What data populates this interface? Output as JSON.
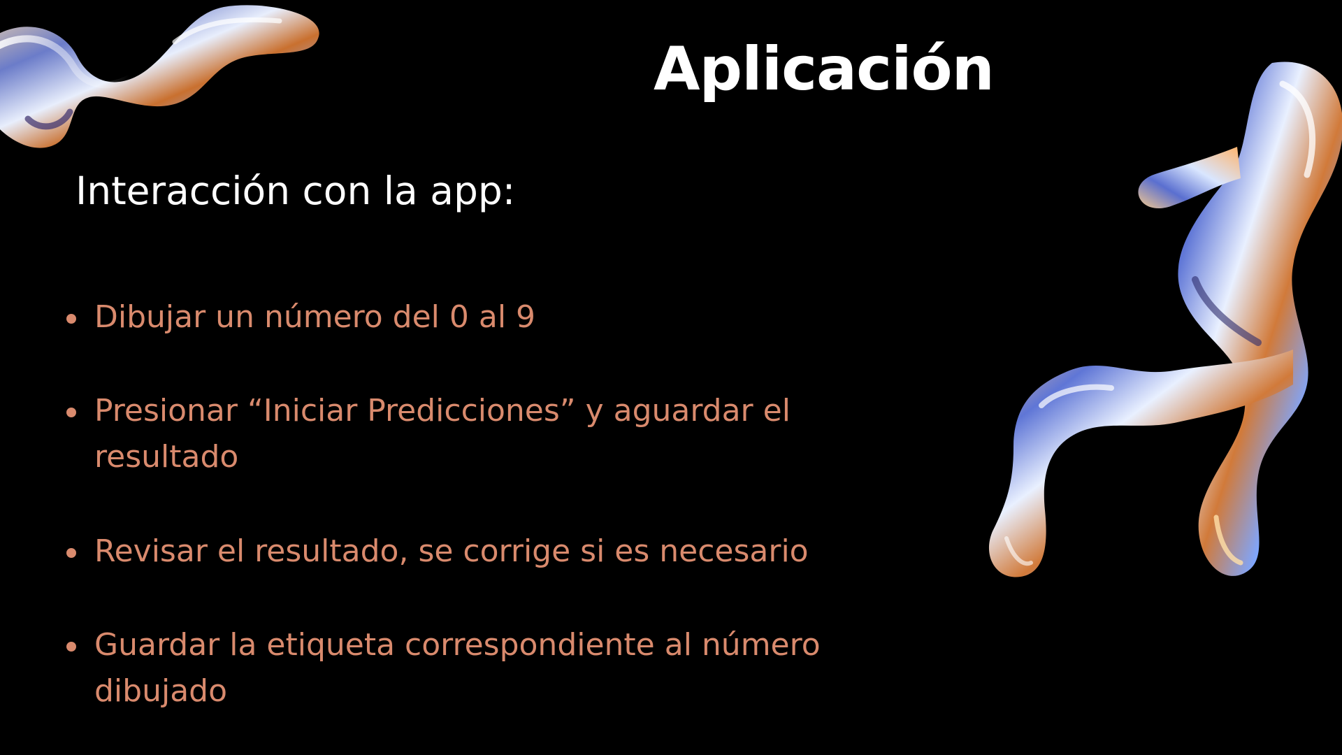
{
  "slide": {
    "title": "Aplicación",
    "subtitle": "Interacción con la app:",
    "bullets": [
      {
        "text": "Dibujar un número del 0 al 9"
      },
      {
        "text": "Presionar “Iniciar Predicciones” y aguardar el resultado"
      },
      {
        "text": "Revisar el resultado, se corrige si es necesario"
      },
      {
        "text": "Guardar la etiqueta correspondiente al número dibujado"
      }
    ]
  },
  "colors": {
    "background": "#000000",
    "title": "#ffffff",
    "bullet_text": "#d98a6d"
  },
  "decorations": {
    "top_left": "liquid-chrome-blob-graphic",
    "right": "liquid-chrome-blob-graphic"
  }
}
